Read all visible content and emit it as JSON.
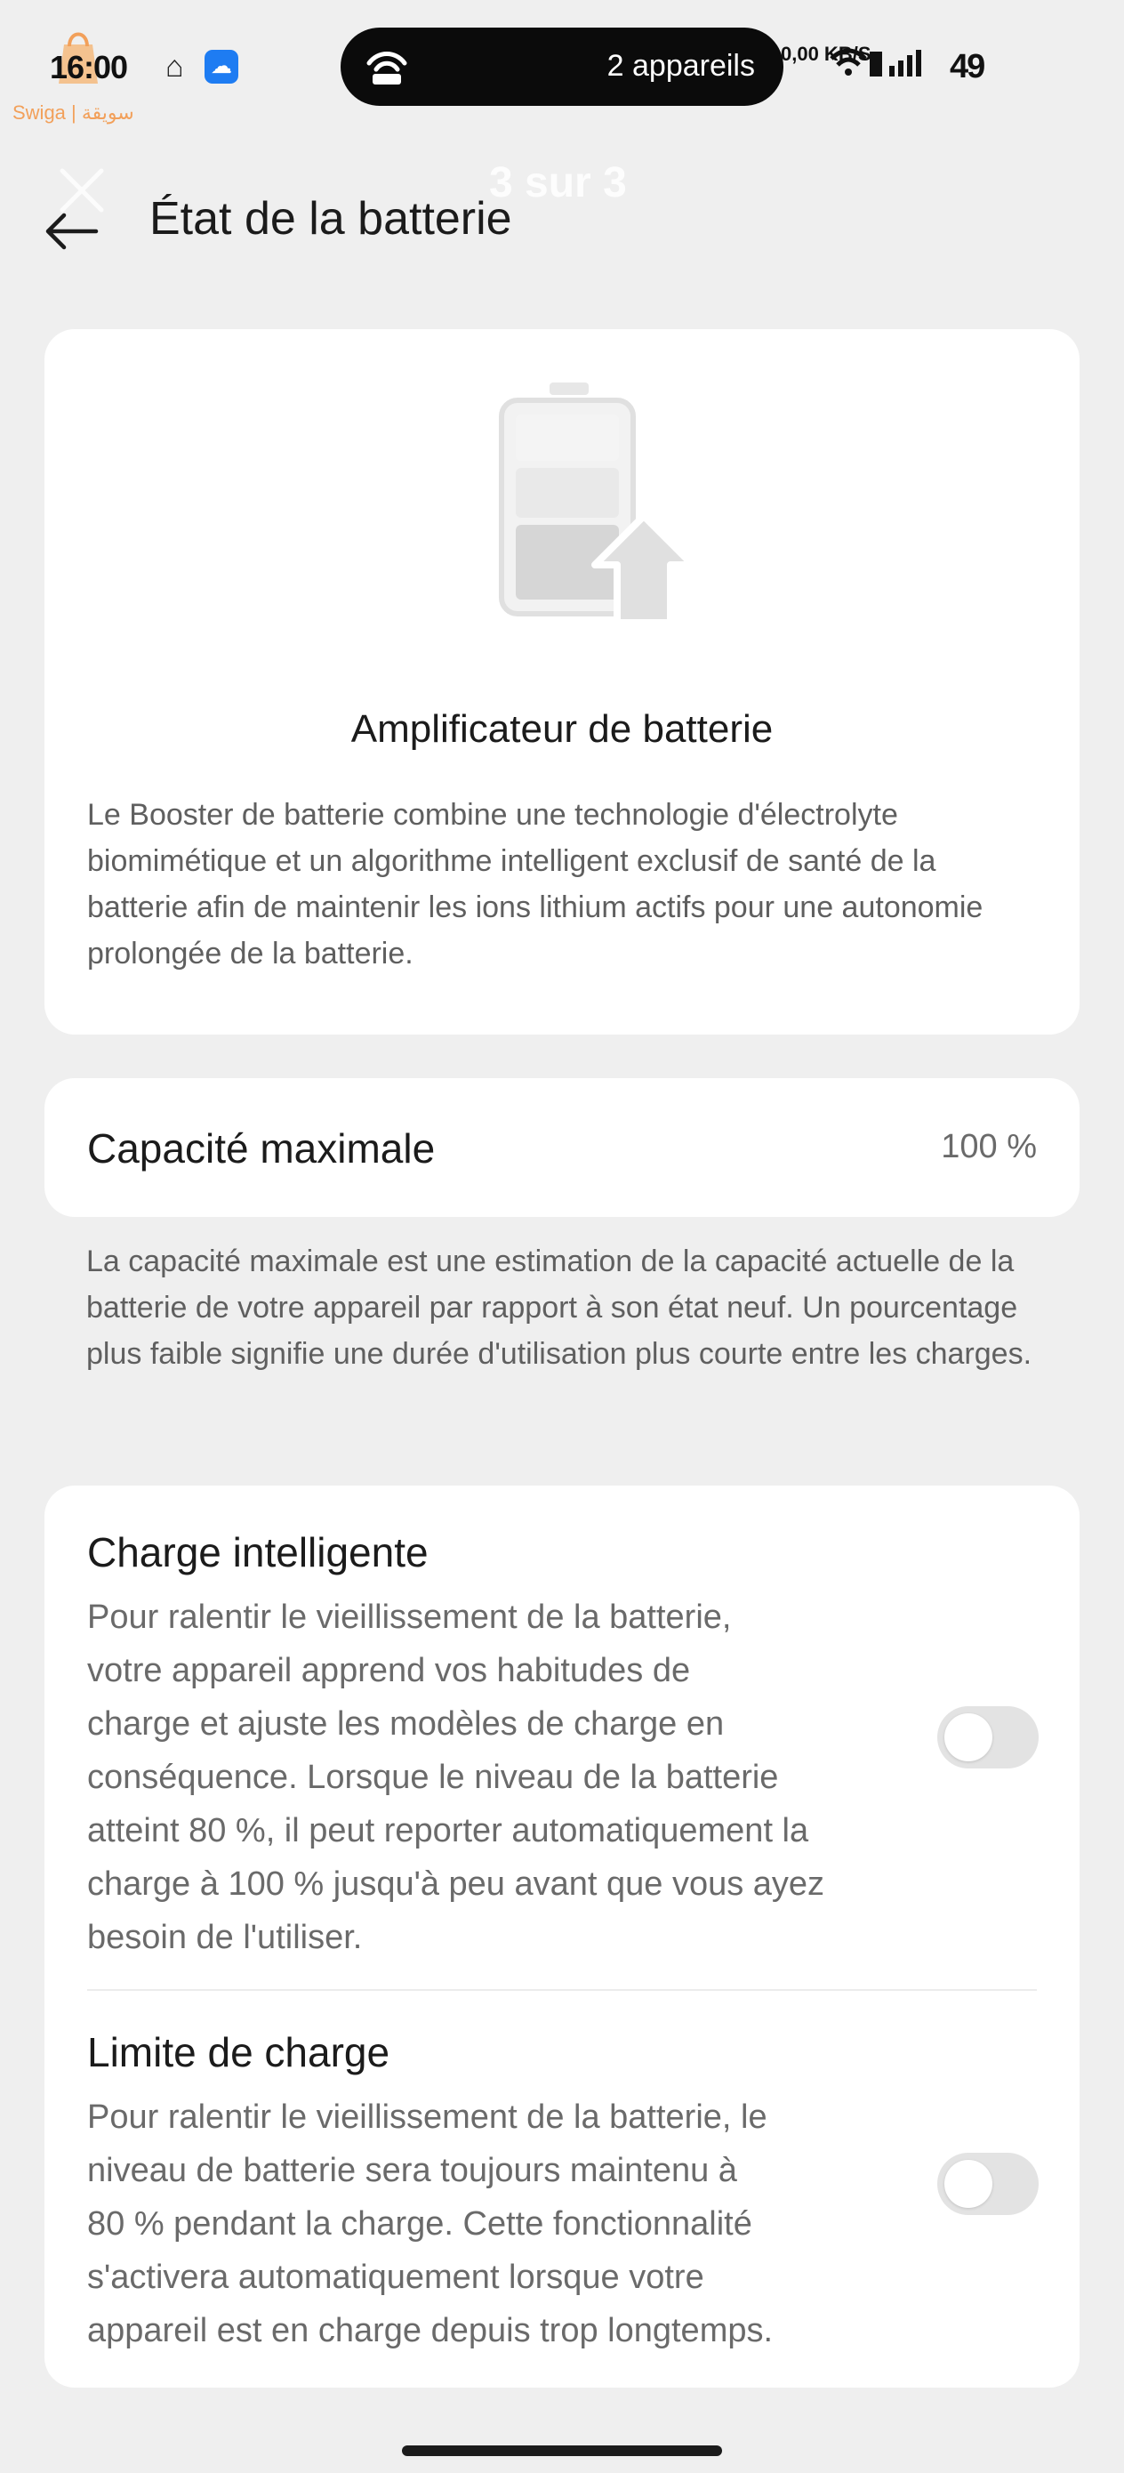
{
  "status_bar": {
    "time": "16:00",
    "watermark_text": "Swiga | سويقة",
    "devices_pill": "2 appareils",
    "network_speed": "0,00 KB/S",
    "battery_text": "49"
  },
  "header": {
    "title": "État de la batterie",
    "overlay_counter": "3 sur 3"
  },
  "booster": {
    "title": "Amplificateur de batterie",
    "description": "Le Booster de batterie combine une technologie d'électrolyte biomimétique et un algorithme intelligent exclusif de santé de la batterie afin de maintenir les ions lithium actifs pour une autonomie prolongée de la batterie."
  },
  "capacity": {
    "label": "Capacité maximale",
    "value": "100 %",
    "description": "La capacité maximale est une estimation de la capacité actuelle de la batterie de votre appareil par rapport à son état neuf. Un pourcentage plus faible signifie une durée d'utilisation plus courte entre les charges."
  },
  "settings": [
    {
      "title": "Charge intelligente",
      "description_lines": [
        "Pour ralentir le vieillissement de la batterie,",
        "votre appareil apprend vos habitudes de",
        "charge et ajuste les modèles de charge en",
        "conséquence. Lorsque le niveau de la batterie",
        "atteint 80 %, il peut reporter automatiquement la",
        "charge à 100 % jusqu'à peu avant que vous ayez",
        "besoin de l'utiliser."
      ],
      "enabled": false
    },
    {
      "title": "Limite de charge",
      "description_lines": [
        "Pour ralentir le vieillissement de la batterie, le",
        "niveau de batterie sera toujours maintenu à",
        "80 % pendant la charge. Cette fonctionnalité",
        "s'activera automatiquement lorsque votre",
        "appareil est en charge depuis trop longtemps."
      ],
      "enabled": false
    }
  ],
  "colors": {
    "background": "#efefef",
    "card": "#ffffff",
    "toggle_off": "#e3e3e3"
  }
}
